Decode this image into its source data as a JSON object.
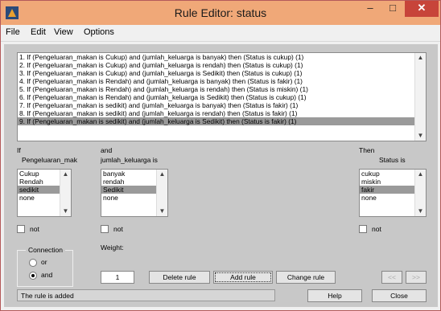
{
  "window": {
    "title": "Rule Editor: status",
    "minimize": "–",
    "maximize": "□",
    "close": "✕"
  },
  "menu": [
    "File",
    "Edit",
    "View",
    "Options"
  ],
  "rules": [
    "1. If (Pengeluaran_makan is Cukup) and (jumlah_keluarga is banyak) then (Status is cukup) (1)",
    "2. If (Pengeluaran_makan is Cukup) and (jumlah_keluarga is rendah) then (Status is cukup) (1)",
    "3. If (Pengeluaran_makan is Cukup) and (jumlah_keluarga is Sedikit) then (Status is cukup) (1)",
    "4. If (Pengeluaran_makan is Rendah) and (jumlah_keluarga is banyak) then (Status is fakir) (1)",
    "5. If (Pengeluaran_makan is Rendah) and (jumlah_keluarga is rendah) then (Status is miskin) (1)",
    "6. If (Pengeluaran_makan is Rendah) and (jumlah_keluarga is Sedikit) then (Status is cukup) (1)",
    "7. If (Pengeluaran_makan is sedikit) and (jumlah_keluarga is banyak) then (Status is fakir) (1)",
    "8. If (Pengeluaran_makan is sedikit) and (jumlah_keluarga is rendah) then (Status is fakir) (1)",
    "9. If (Pengeluaran_makan is sedikit) and (jumlah_keluarga is Sedikit) then (Status is fakir) (1)"
  ],
  "selected_rule": 9,
  "if_block": {
    "label1": "If",
    "label2": "Pengeluaran_mak",
    "items": [
      "Cukup",
      "Rendah",
      "sedikit",
      "none"
    ],
    "selected": "sedikit",
    "not_label": "not"
  },
  "and_block": {
    "label1": "and",
    "label2": "jumlah_keluarga is",
    "items": [
      "banyak",
      "rendah",
      "Sedikit",
      "none"
    ],
    "selected": "Sedikit",
    "not_label": "not"
  },
  "then_block": {
    "label1": "Then",
    "label2": "Status is",
    "items": [
      "cukup",
      "miskin",
      "fakir",
      "none"
    ],
    "selected": "fakir",
    "not_label": "not"
  },
  "connection": {
    "title": "Connection",
    "options": [
      "or",
      "and"
    ],
    "selected": "and"
  },
  "weight": {
    "label": "Weight:",
    "value": "1"
  },
  "buttons": {
    "delete": "Delete rule",
    "add": "Add rule",
    "change": "Change rule",
    "prev": "<<",
    "next": ">>",
    "help": "Help",
    "close": "Close"
  },
  "status_message": "The rule is added"
}
